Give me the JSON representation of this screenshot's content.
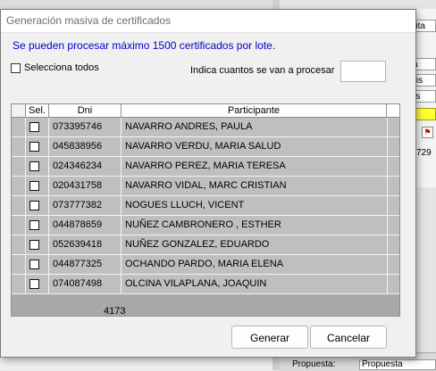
{
  "background": {
    "cells": [
      "nalita",
      "tica",
      "a dis",
      "eles"
    ],
    "icon": "warning-flag-icon",
    "number": "729",
    "bottom_label": "Propuesta:",
    "bottom_value": "Propuesta"
  },
  "dialog": {
    "title": "Generación masiva de certificados",
    "info": "Se pueden procesar  máximo 1500 certificados por lote.",
    "select_all_label": "Selecciona todos",
    "count_label": "Indica cuantos se van a procesar",
    "count_value": "",
    "grid": {
      "columns": [
        "Sel.",
        "Dni",
        "Participante"
      ],
      "rows": [
        {
          "dni": "073395746",
          "participante": "NAVARRO ANDRES, PAULA"
        },
        {
          "dni": "045838956",
          "participante": "NAVARRO  VERDU, MARIA SALUD"
        },
        {
          "dni": "024346234",
          "participante": "NAVARRO PEREZ, MARIA TERESA"
        },
        {
          "dni": "020431758",
          "participante": "NAVARRO VIDAL, MARC CRISTIAN"
        },
        {
          "dni": "073777382",
          "participante": "NOGUES LLUCH, VICENT"
        },
        {
          "dni": "044878659",
          "participante": "NUÑEZ CAMBRONERO , ESTHER"
        },
        {
          "dni": "052639418",
          "participante": "NUÑEZ GONZALEZ, EDUARDO"
        },
        {
          "dni": "044877325",
          "participante": "OCHANDO PARDO, MARIA ELENA"
        },
        {
          "dni": "074087498",
          "participante": "OLCINA VILAPLANA, JOAQUIN"
        }
      ],
      "total": "4173"
    },
    "buttons": {
      "generate": "Generar",
      "cancel": "Cancelar"
    }
  }
}
